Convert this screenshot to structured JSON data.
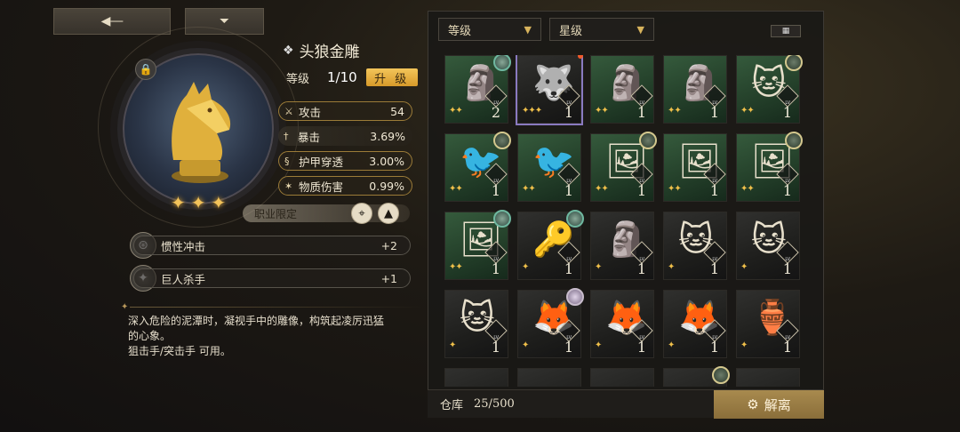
{
  "nav": {
    "back_icon": "back-arrow-icon",
    "menu_icon": "home-tray-icon"
  },
  "item": {
    "name": "头狼金雕",
    "level_label": "等级",
    "level_value": "1/10",
    "upgrade_label": "升 级",
    "rarity_stars": 3,
    "stats": [
      {
        "icon": "sword-icon",
        "label": "攻击",
        "value": "54",
        "boxed": true
      },
      {
        "icon": "crit-icon",
        "label": "暴击",
        "value": "3.69%",
        "boxed": false
      },
      {
        "icon": "armor-pierce-icon",
        "label": "护甲穿透",
        "value": "3.00%",
        "boxed": true
      },
      {
        "icon": "physical-damage-icon",
        "label": "物质伤害",
        "value": "0.99%",
        "boxed": true
      }
    ],
    "class_restriction_label": "职业限定",
    "skills": [
      {
        "label": "惯性冲击",
        "value": "+2"
      },
      {
        "label": "巨人杀手",
        "value": "+1"
      }
    ],
    "description": [
      "深入危险的泥潭时，凝视手中的雕像，构筑起凌厉迅猛",
      "的心象。",
      "狙击手/突击手 可用。"
    ]
  },
  "inventory": {
    "filter_level": "等级",
    "filter_stars": "星级",
    "storage_label": "仓库",
    "storage_count": "25/500",
    "dismantle_label": "解离",
    "cards": [
      {
        "bg": "green",
        "fig": "🗿",
        "level": "2",
        "stars": 2,
        "badge": "teal"
      },
      {
        "bg": "dark",
        "fig": "🐺",
        "level": "1",
        "stars": 3,
        "badge": "none",
        "selected": true
      },
      {
        "bg": "green",
        "fig": "🗿",
        "level": "1",
        "stars": 2,
        "badge": "none"
      },
      {
        "bg": "green",
        "fig": "🗿",
        "level": "1",
        "stars": 2,
        "badge": "none"
      },
      {
        "bg": "green",
        "fig": "🐱",
        "level": "1",
        "stars": 2,
        "badge": "gold"
      },
      {
        "bg": "green",
        "fig": "🐦",
        "level": "1",
        "stars": 2,
        "badge": "gold"
      },
      {
        "bg": "green",
        "fig": "🐦",
        "level": "1",
        "stars": 2,
        "badge": "none"
      },
      {
        "bg": "green",
        "fig": "🖼",
        "level": "1",
        "stars": 2,
        "badge": "gold"
      },
      {
        "bg": "green",
        "fig": "🖼",
        "level": "1",
        "stars": 2,
        "badge": "none"
      },
      {
        "bg": "green",
        "fig": "🖼",
        "level": "1",
        "stars": 2,
        "badge": "gold"
      },
      {
        "bg": "green",
        "fig": "🖼",
        "level": "1",
        "stars": 2,
        "badge": "teal"
      },
      {
        "bg": "dark",
        "fig": "🔑",
        "level": "1",
        "stars": 1,
        "badge": "teal"
      },
      {
        "bg": "dark",
        "fig": "🗿",
        "level": "1",
        "stars": 1,
        "badge": "none"
      },
      {
        "bg": "dark",
        "fig": "🐱",
        "level": "1",
        "stars": 1,
        "badge": "none"
      },
      {
        "bg": "dark",
        "fig": "🐱",
        "level": "1",
        "stars": 1,
        "badge": "none"
      },
      {
        "bg": "dark",
        "fig": "🐱",
        "level": "1",
        "stars": 1,
        "badge": "none"
      },
      {
        "bg": "dark",
        "fig": "🦊",
        "level": "1",
        "stars": 1,
        "badge": "pale"
      },
      {
        "bg": "dark",
        "fig": "🦊",
        "level": "1",
        "stars": 1,
        "badge": "none"
      },
      {
        "bg": "dark",
        "fig": "🦊",
        "level": "1",
        "stars": 1,
        "badge": "none"
      },
      {
        "bg": "dark",
        "fig": "🏺",
        "level": "1",
        "stars": 1,
        "badge": "none"
      },
      {
        "bg": "dark",
        "fig": "",
        "level": "",
        "stars": 0,
        "badge": "none"
      },
      {
        "bg": "dark",
        "fig": "",
        "level": "",
        "stars": 0,
        "badge": "none"
      },
      {
        "bg": "dark",
        "fig": "",
        "level": "",
        "stars": 0,
        "badge": "none"
      },
      {
        "bg": "dark",
        "fig": "",
        "level": "",
        "stars": 0,
        "badge": "gold"
      },
      {
        "bg": "dark",
        "fig": "",
        "level": "",
        "stars": 0,
        "badge": "none"
      }
    ]
  },
  "colors": {
    "accent_gold": "#d79a2a",
    "panel_bg": "#1a1816"
  }
}
